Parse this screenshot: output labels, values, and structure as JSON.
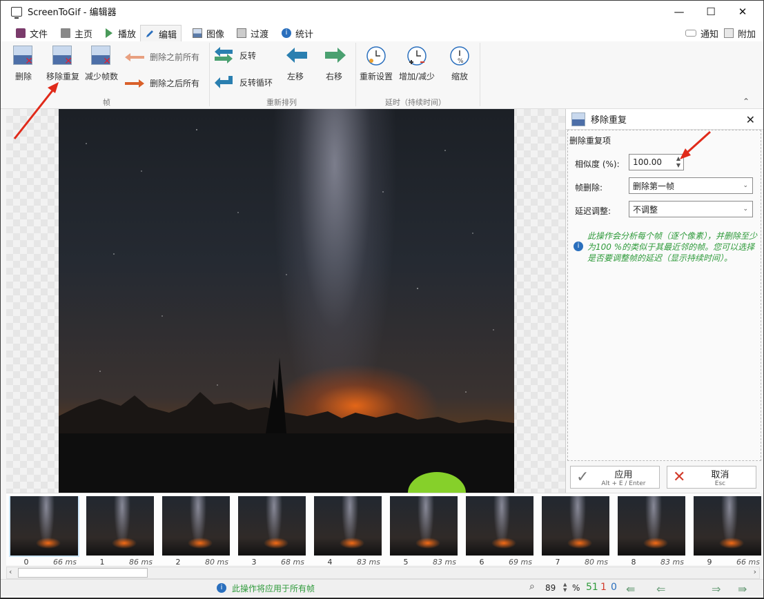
{
  "window": {
    "title": "ScreenToGif - 编辑器",
    "minimize": "—",
    "maximize": "☐",
    "close": "✕"
  },
  "tabs": [
    {
      "label": "文件"
    },
    {
      "label": "主页"
    },
    {
      "label": "播放"
    },
    {
      "label": "编辑"
    },
    {
      "label": "图像"
    },
    {
      "label": "过渡"
    },
    {
      "label": "统计"
    }
  ],
  "top_right": {
    "notify": "通知",
    "attach": "附加"
  },
  "ribbon": {
    "frames": {
      "delete": "删除",
      "remove_duplicates": "移除重复",
      "reduce": "减少帧数",
      "delete_before": "删除之前所有",
      "delete_after": "删除之后所有",
      "group": "帧"
    },
    "reorder": {
      "reverse": "反转",
      "yoyo": "反转循环",
      "move_left": "左移",
      "move_right": "右移",
      "group": "重新排列"
    },
    "delay": {
      "override": "重新设置",
      "increase_decrease": "增加/减少",
      "scale": "缩放",
      "group": "延时（持续时间）"
    }
  },
  "panel": {
    "title": "移除重复",
    "section": "删除重复项",
    "similarity_label": "相似度 (%):",
    "similarity_value": "100.00",
    "frame_removal_label": "帧删除:",
    "frame_removal_value": "删除第一帧",
    "delay_adjust_label": "延迟调整:",
    "delay_adjust_value": "不调整",
    "info_text": "此操作会分析每个帧（逐个像素），并删除至少为100 %的类似于其最近邻的帧。您可以选择是否要调整帧的延迟（显示持续时间）。",
    "apply_label": "应用",
    "apply_shortcut": "Alt + E / Enter",
    "cancel_label": "取消",
    "cancel_shortcut": "Esc"
  },
  "frames": [
    {
      "index": "0",
      "delay": "66 ms"
    },
    {
      "index": "1",
      "delay": "86 ms"
    },
    {
      "index": "2",
      "delay": "80 ms"
    },
    {
      "index": "3",
      "delay": "68 ms"
    },
    {
      "index": "4",
      "delay": "83 ms"
    },
    {
      "index": "5",
      "delay": "83 ms"
    },
    {
      "index": "6",
      "delay": "69 ms"
    },
    {
      "index": "7",
      "delay": "80 ms"
    },
    {
      "index": "8",
      "delay": "83 ms"
    },
    {
      "index": "9",
      "delay": "66 ms"
    }
  ],
  "status": {
    "message": "此操作将应用于所有帧",
    "zoom": "89",
    "percent": "%",
    "total_frames": "51",
    "selected_frames": "1",
    "current_frame": "0"
  },
  "colors": {
    "accent_blue": "#2a6fbd",
    "green": "#2e9a3a",
    "red": "#d23b2b"
  }
}
